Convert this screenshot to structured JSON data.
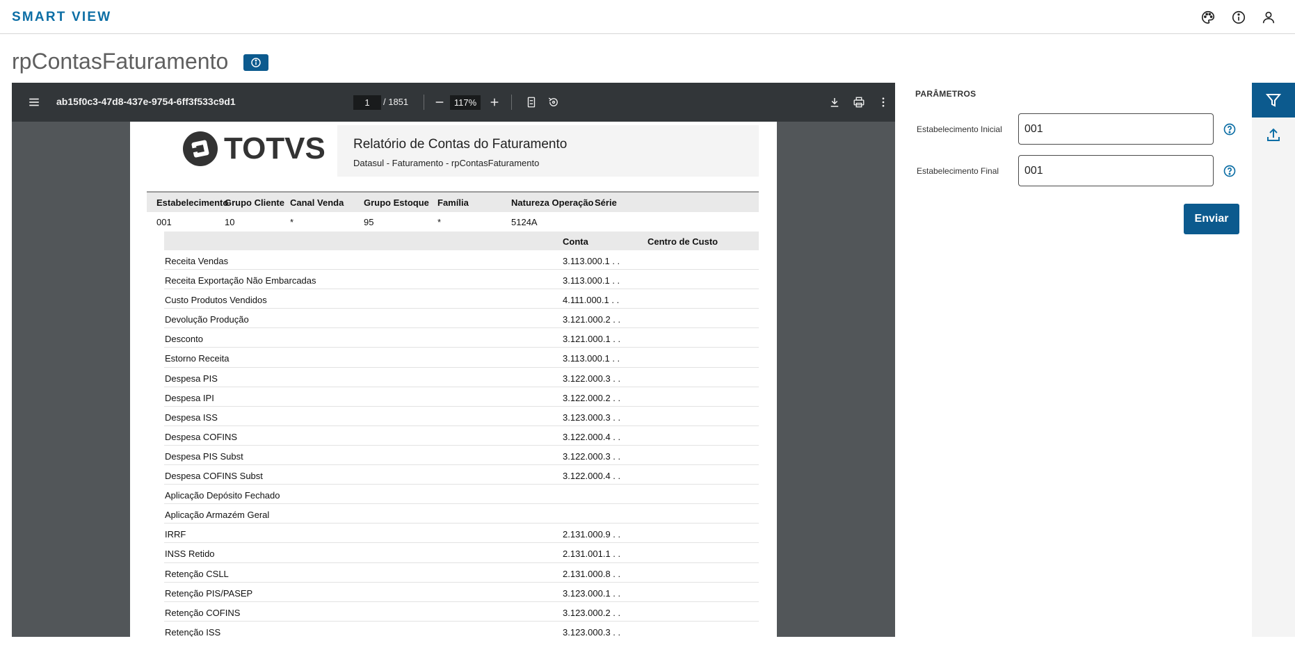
{
  "app": {
    "brand": "SMART VIEW"
  },
  "header": {
    "title": "rpContasFaturamento"
  },
  "viewer": {
    "doc_name": "ab15f0c3-47d8-437e-9754-6ff3f533c9d1",
    "page_current": "1",
    "page_total": "/ 1851",
    "zoom": "117%"
  },
  "report": {
    "logo_text": "TOTVS",
    "title": "Relatório  de Contas do Faturamento",
    "subtitle": "Datasul - Faturamento - rpContasFaturamento",
    "headers": [
      "Estabelecimento",
      "Grupo Cliente",
      "Canal Venda",
      "Grupo Estoque",
      "Família",
      "Natureza Operação",
      "Série"
    ],
    "values": [
      "001",
      "10",
      "*",
      "95",
      "*",
      "5124A",
      ""
    ],
    "sub_headers": [
      "Conta",
      "Centro de Custo"
    ],
    "accounts": [
      {
        "name": "Receita Vendas",
        "code": "3.113.000.1  .  ."
      },
      {
        "name": "Receita Exportação Não Embarcadas",
        "code": "3.113.000.1  .  ."
      },
      {
        "name": "Custo Produtos Vendidos",
        "code": "4.111.000.1  .  ."
      },
      {
        "name": "Devolução Produção",
        "code": "3.121.000.2  .  ."
      },
      {
        "name": "Desconto",
        "code": "3.121.000.1  .  ."
      },
      {
        "name": "Estorno Receita",
        "code": "3.113.000.1  .  ."
      },
      {
        "name": "Despesa PIS",
        "code": "3.122.000.3  .  ."
      },
      {
        "name": "Despesa IPI",
        "code": "3.122.000.2  .  ."
      },
      {
        "name": "Despesa ISS",
        "code": "3.123.000.3  .  ."
      },
      {
        "name": "Despesa COFINS",
        "code": "3.122.000.4  .  ."
      },
      {
        "name": "Despesa PIS Subst",
        "code": "3.122.000.3  .  ."
      },
      {
        "name": "Despesa COFINS Subst",
        "code": "3.122.000.4  .  ."
      },
      {
        "name": "Aplicação Depósito Fechado",
        "code": ""
      },
      {
        "name": "Aplicação Armazém Geral",
        "code": ""
      },
      {
        "name": "IRRF",
        "code": "2.131.000.9  .  ."
      },
      {
        "name": "INSS Retido",
        "code": "2.131.001.1  .  ."
      },
      {
        "name": "Retenção CSLL",
        "code": "2.131.000.8  .  ."
      },
      {
        "name": "Retenção PIS/PASEP",
        "code": "3.123.000.1  .  ."
      },
      {
        "name": "Retenção COFINS",
        "code": "3.123.000.2  .  ."
      },
      {
        "name": "Retenção ISS",
        "code": "3.123.000.3  .  ."
      }
    ]
  },
  "params": {
    "title": "PARÂMETROS",
    "fields": [
      {
        "label": "Estabelecimento Inicial",
        "value": "001"
      },
      {
        "label": "Estabelecimento Final",
        "value": "001"
      }
    ],
    "submit_label": "Enviar"
  },
  "colors": {
    "brand": "#0c6ea5",
    "primary": "#0c5a8e",
    "toolbar": "#323639"
  },
  "icons": [
    "palette-icon",
    "info-icon",
    "user-icon",
    "menu-icon",
    "minus-icon",
    "plus-icon",
    "fit-page-icon",
    "rotate-icon",
    "download-icon",
    "print-icon",
    "more-vertical-icon",
    "help-icon",
    "filter-icon",
    "upload-icon"
  ]
}
